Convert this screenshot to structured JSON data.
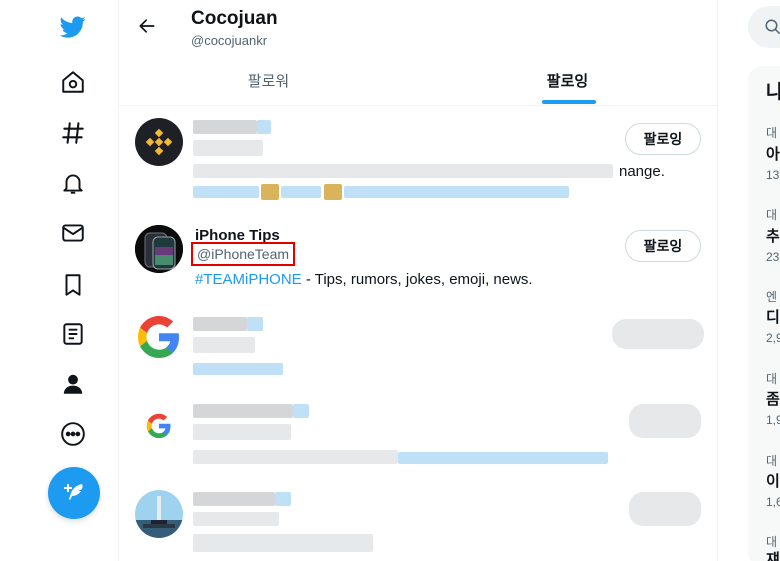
{
  "profile": {
    "name": "Cocojuan",
    "handle": "@cocojuankr"
  },
  "tabs": [
    {
      "label": "팔로워"
    },
    {
      "label": "팔로잉"
    }
  ],
  "users": [
    {
      "bio_visible_tail": "nange.",
      "follow_label": "팔로잉"
    },
    {
      "name": "iPhone Tips",
      "handle": "@iPhoneTeam",
      "hashtag": "#TEAMiPHONE",
      "bio_rest": " - Tips, rumors, jokes, emoji, news.",
      "follow_label": "팔로잉"
    },
    {},
    {},
    {}
  ],
  "right_panel": {
    "header": "나",
    "trends": [
      {
        "category": "대",
        "title": "아",
        "count": "13,"
      },
      {
        "category": "대",
        "title": "추",
        "count": "23"
      },
      {
        "category": "엔",
        "title": "디",
        "count": "2,9"
      },
      {
        "category": "대",
        "title": "좀",
        "count": "1,9"
      },
      {
        "category": "대",
        "title": "이",
        "count": "1,6"
      },
      {
        "category": "대",
        "title": "쟤",
        "count": ""
      }
    ]
  },
  "colors": {
    "accent": "#1d9bf0",
    "highlight_box": "#e00000",
    "secondary_text": "#536471"
  }
}
